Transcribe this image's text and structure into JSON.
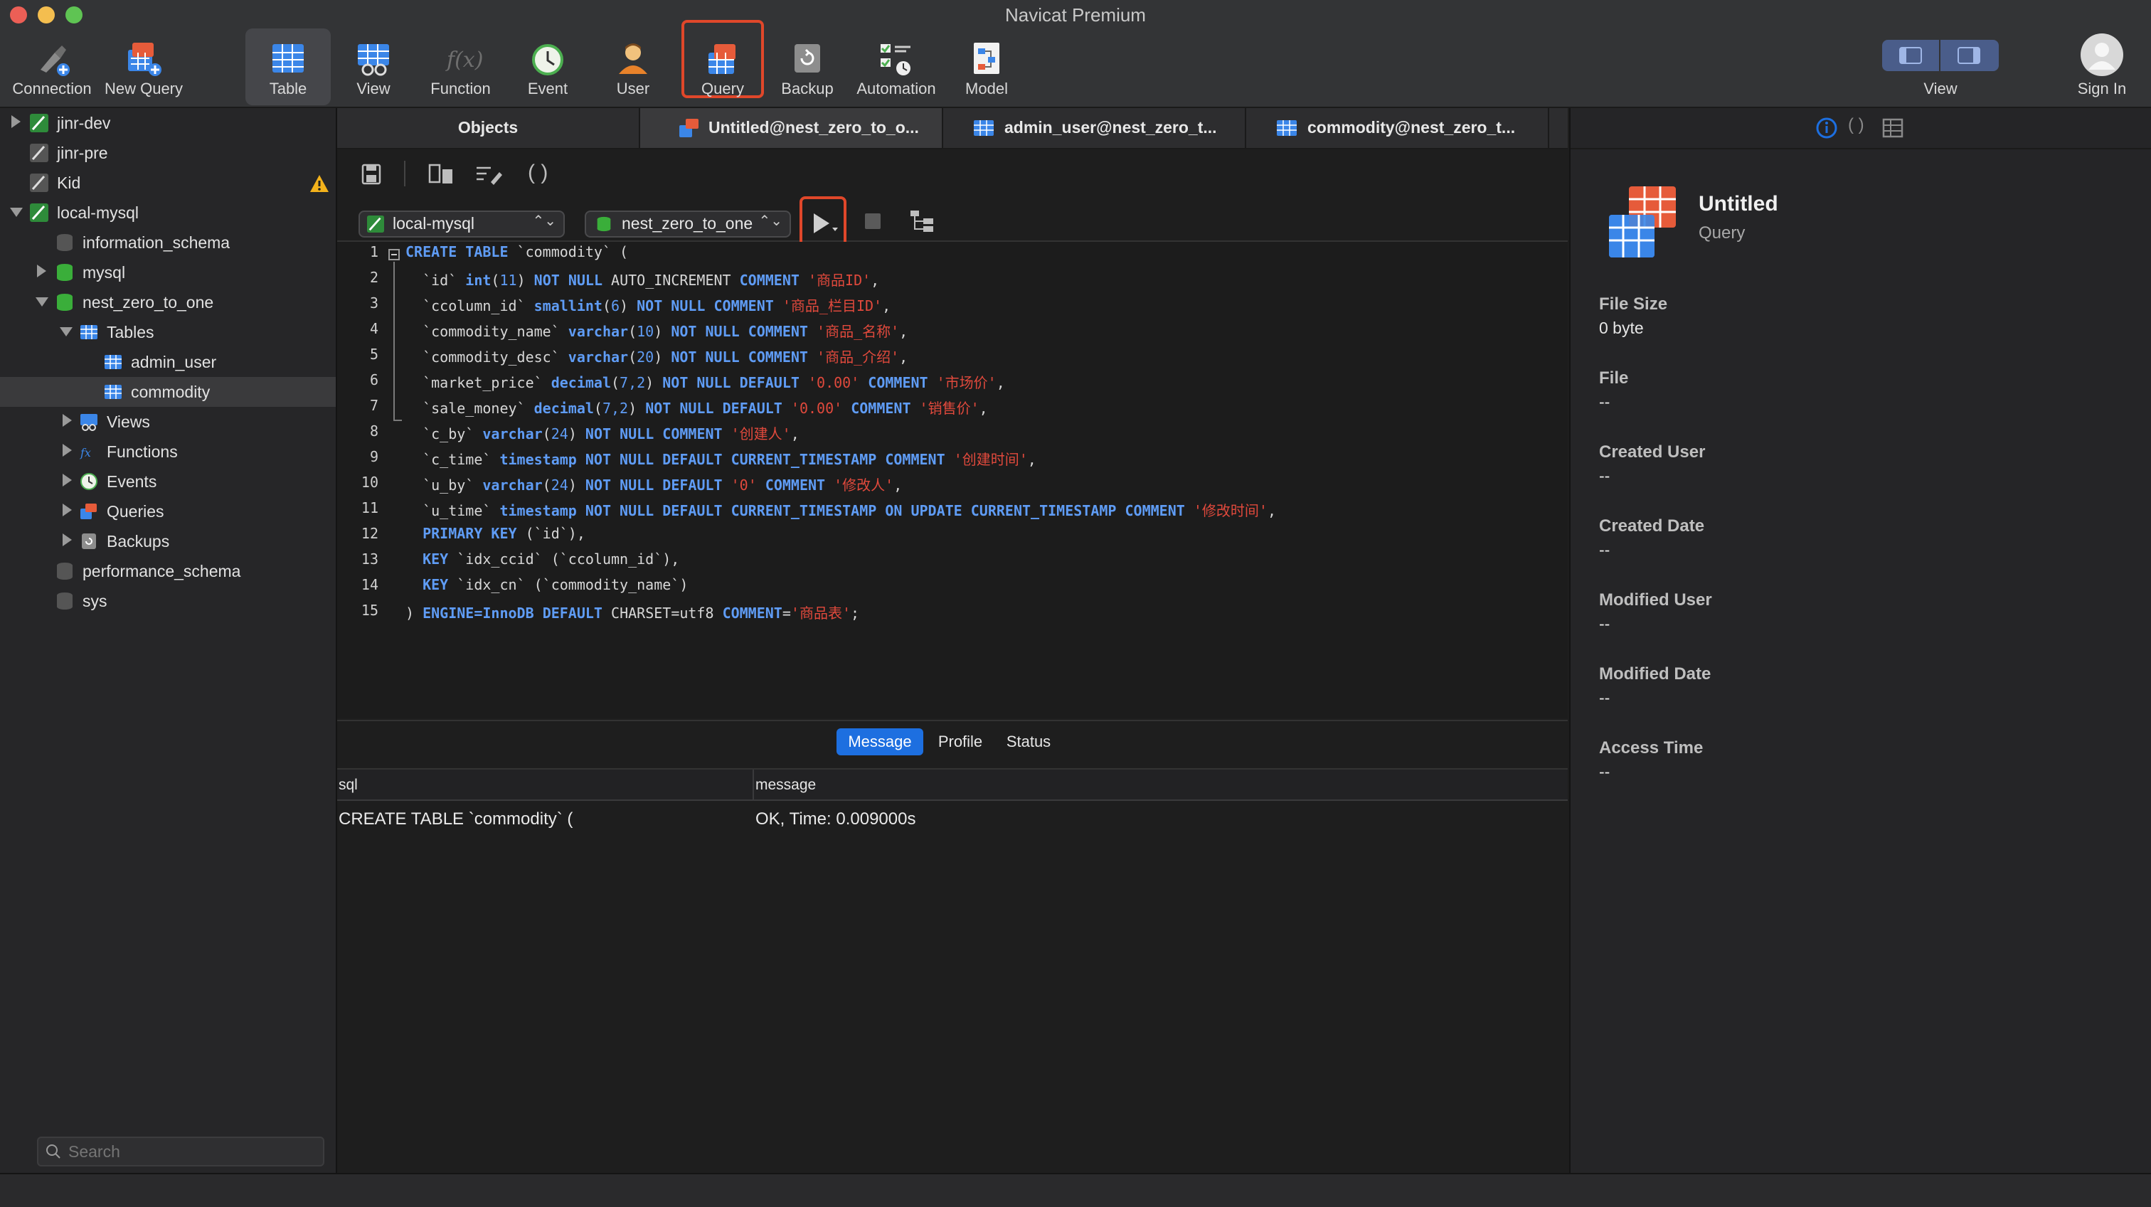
{
  "window": {
    "title": "Navicat Premium"
  },
  "toolbar": {
    "buttons": [
      {
        "label": "Connection",
        "icon": "connection-icon"
      },
      {
        "label": "New Query",
        "icon": "new-query-icon"
      },
      {
        "label": "Table",
        "icon": "table-icon"
      },
      {
        "label": "View",
        "icon": "view-icon"
      },
      {
        "label": "Function",
        "icon": "function-icon"
      },
      {
        "label": "Event",
        "icon": "event-clock-icon"
      },
      {
        "label": "User",
        "icon": "user-icon"
      },
      {
        "label": "Query",
        "icon": "query-icon"
      },
      {
        "label": "Backup",
        "icon": "backup-icon"
      },
      {
        "label": "Automation",
        "icon": "automation-icon"
      },
      {
        "label": "Model",
        "icon": "model-icon"
      }
    ],
    "right_view_label": "View",
    "sign_in_label": "Sign In"
  },
  "sidebar": {
    "items": [
      {
        "label": "jinr-dev",
        "expanded": false
      },
      {
        "label": "jinr-pre"
      },
      {
        "label": "Kid",
        "warning": true
      },
      {
        "label": "local-mysql",
        "expanded": true
      },
      {
        "label": "information_schema"
      },
      {
        "label": "mysql",
        "expanded": false
      },
      {
        "label": "nest_zero_to_one",
        "expanded": true
      },
      {
        "label": "Tables",
        "expanded": true
      },
      {
        "label": "admin_user"
      },
      {
        "label": "commodity",
        "selected": true
      },
      {
        "label": "Views"
      },
      {
        "label": "Functions"
      },
      {
        "label": "Events"
      },
      {
        "label": "Queries"
      },
      {
        "label": "Backups"
      },
      {
        "label": "performance_schema"
      },
      {
        "label": "sys"
      }
    ],
    "search_placeholder": "Search"
  },
  "tabs": [
    {
      "label": "Objects"
    },
    {
      "label": "Untitled@nest_zero_to_o..."
    },
    {
      "label": "admin_user@nest_zero_t..."
    },
    {
      "label": "commodity@nest_zero_t..."
    }
  ],
  "query_toolbar": {
    "connection_select": "local-mysql",
    "database_select": "nest_zero_to_one"
  },
  "editor": {
    "line_numbers": [
      "1",
      "2",
      "3",
      "4",
      "5",
      "6",
      "7",
      "8",
      "9",
      "10",
      "11",
      "12",
      "13",
      "14",
      "15"
    ],
    "lines": [
      "CREATE TABLE `commodity` (",
      "  `id` int(11) NOT NULL AUTO_INCREMENT COMMENT '商品ID',",
      "  `ccolumn_id` smallint(6) NOT NULL COMMENT '商品_栏目ID',",
      "  `commodity_name` varchar(10) NOT NULL COMMENT '商品_名称',",
      "  `commodity_desc` varchar(20) NOT NULL COMMENT '商品_介绍',",
      "  `market_price` decimal(7,2) NOT NULL DEFAULT '0.00' COMMENT '市场价',",
      "  `sale_money` decimal(7,2) NOT NULL DEFAULT '0.00' COMMENT '销售价',",
      "  `c_by` varchar(24) NOT NULL COMMENT '创建人',",
      "  `c_time` timestamp NOT NULL DEFAULT CURRENT_TIMESTAMP COMMENT '创建时间',",
      "  `u_by` varchar(24) NOT NULL DEFAULT '0' COMMENT '修改人',",
      "  `u_time` timestamp NOT NULL DEFAULT CURRENT_TIMESTAMP ON UPDATE CURRENT_TIMESTAMP COMMENT '修改时间',",
      "  PRIMARY KEY (`id`),",
      "  KEY `idx_ccid` (`ccolumn_id`),",
      "  KEY `idx_cn` (`commodity_name`)",
      ") ENGINE=InnoDB DEFAULT CHARSET=utf8 COMMENT='商品表';"
    ]
  },
  "results": {
    "tabs": [
      {
        "label": "Message",
        "active": true
      },
      {
        "label": "Profile"
      },
      {
        "label": "Status"
      }
    ],
    "columns": [
      "sql",
      "message"
    ],
    "rows": [
      {
        "sql": "CREATE TABLE `commodity` (",
        "message": "OK, Time: 0.009000s"
      }
    ]
  },
  "info_panel": {
    "name": "Untitled",
    "type": "Query",
    "fields": [
      {
        "label": "File Size",
        "value": "0 byte"
      },
      {
        "label": "File",
        "value": "--"
      },
      {
        "label": "Created User",
        "value": "--"
      },
      {
        "label": "Created Date",
        "value": "--"
      },
      {
        "label": "Modified User",
        "value": "--"
      },
      {
        "label": "Modified Date",
        "value": "--"
      },
      {
        "label": "Access Time",
        "value": "--"
      }
    ]
  },
  "colors": {
    "accent": "#1d6fe0",
    "highlight_outline": "#e0472a",
    "keyword": "#5f9cf5",
    "string": "#e0493c",
    "db_green": "#3aae3a",
    "warning": "#f3b21b"
  }
}
